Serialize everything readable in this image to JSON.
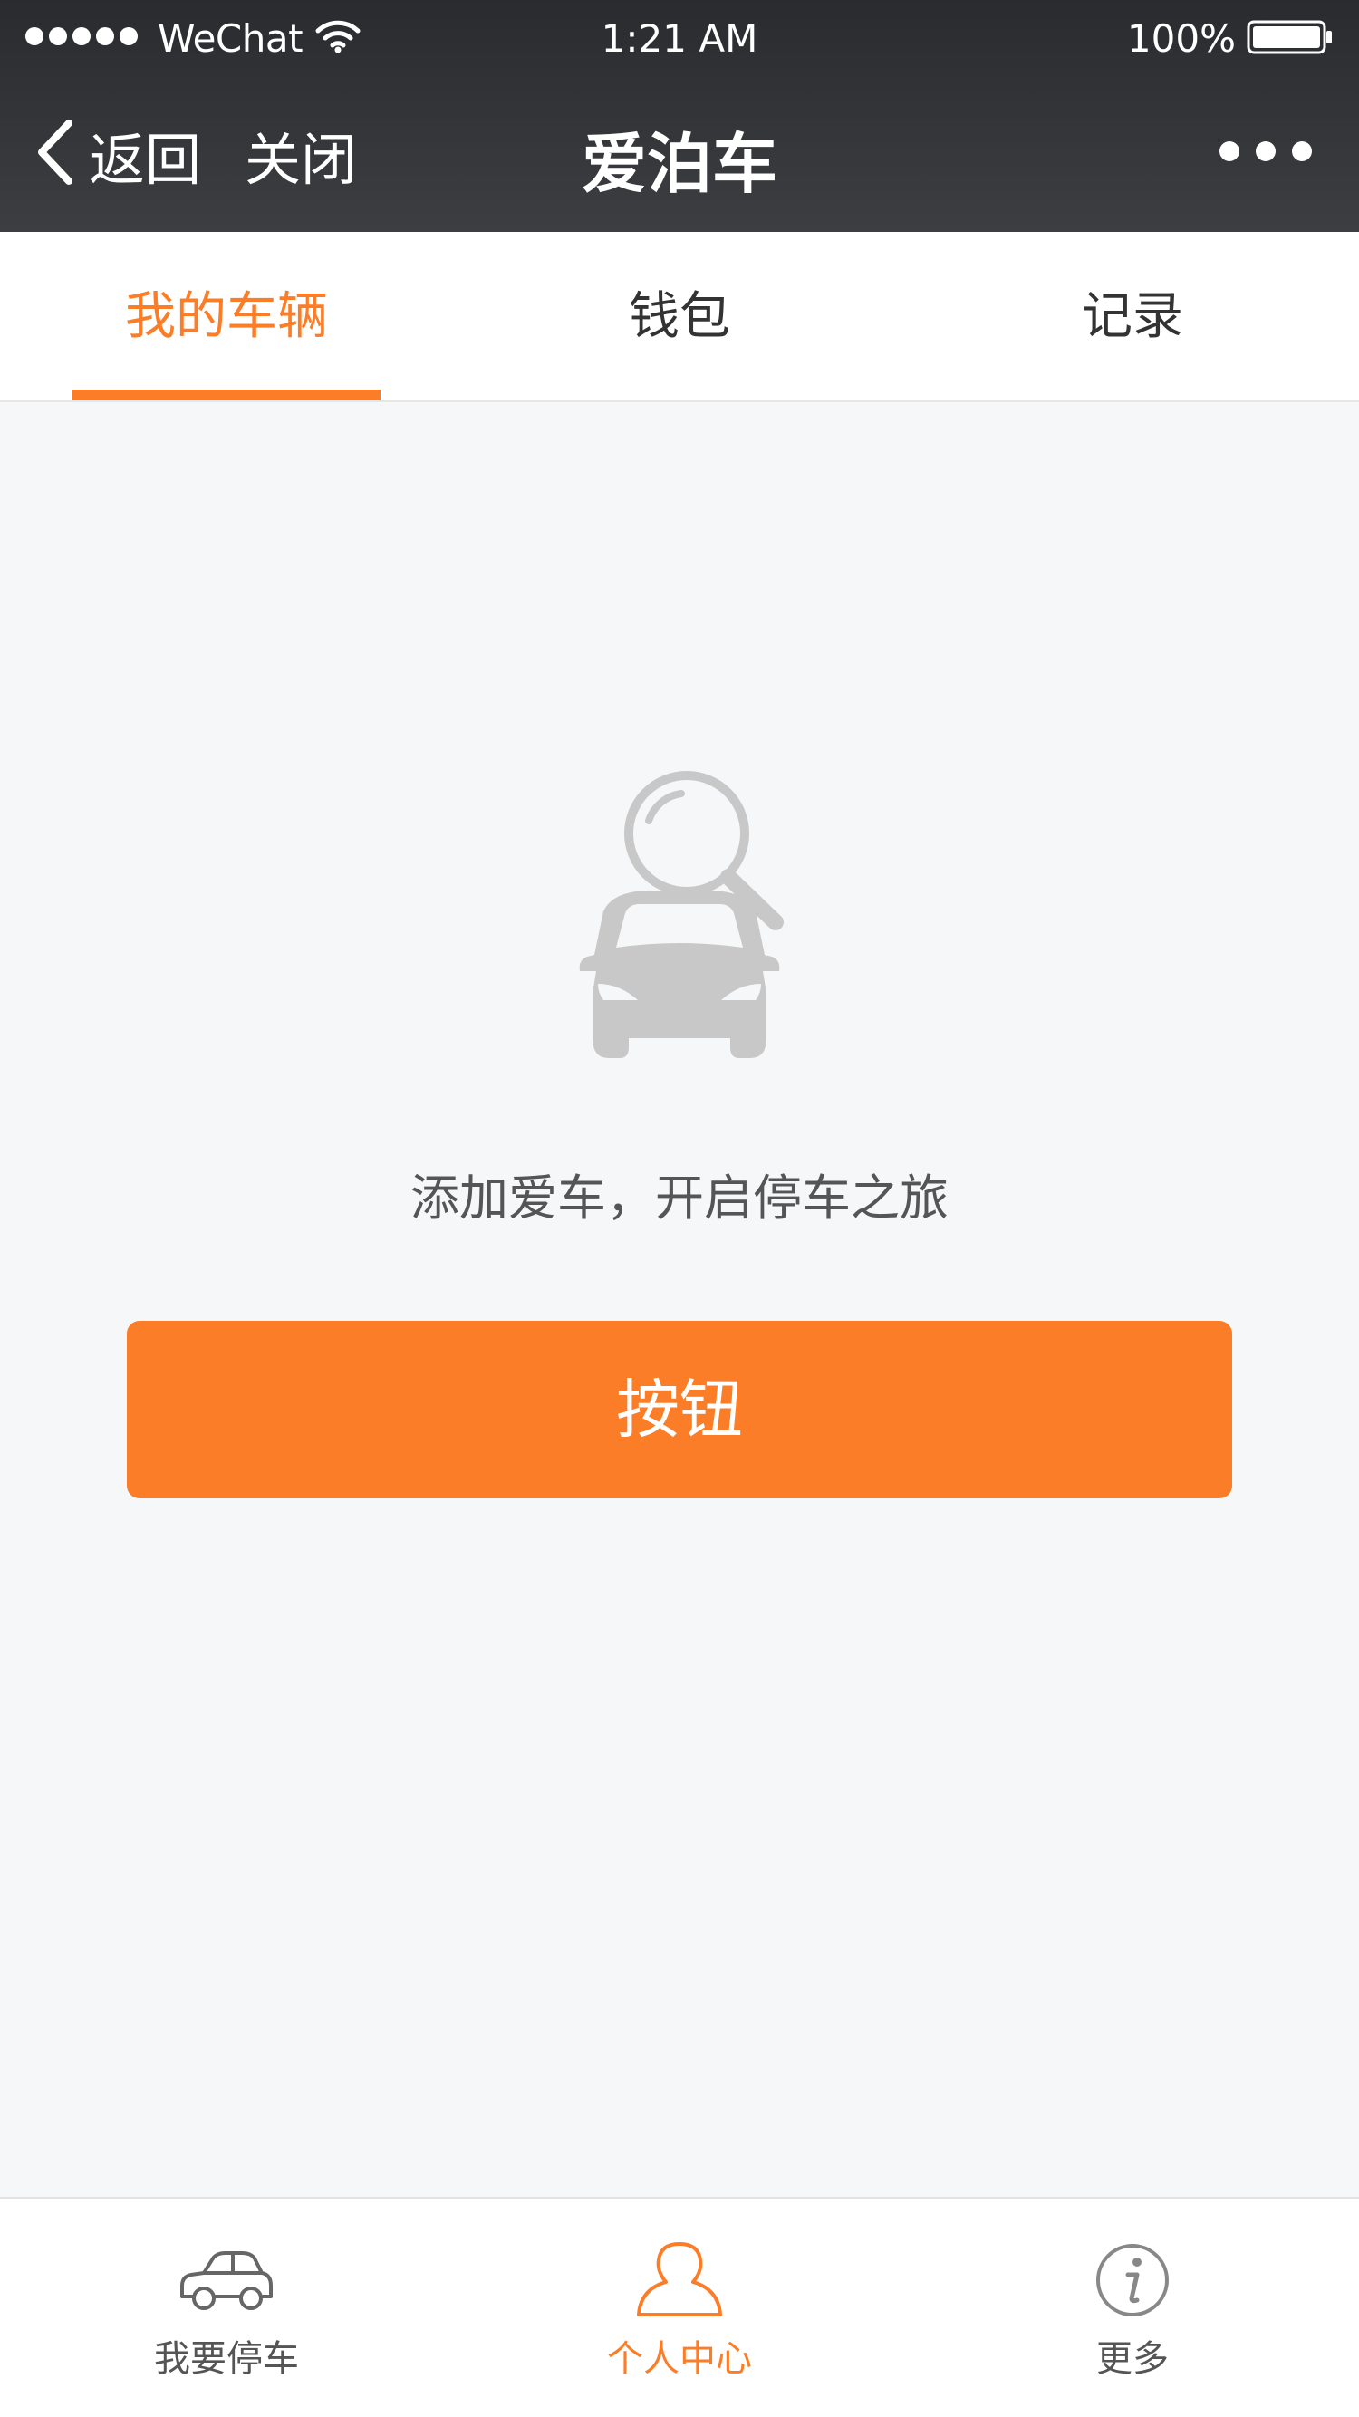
{
  "status_bar": {
    "carrier": "WeChat",
    "time": "1:21 AM",
    "battery": "100%"
  },
  "nav": {
    "back_label": "返回",
    "close_label": "关闭",
    "title": "爱泊车"
  },
  "tabs": [
    {
      "label": "我的车辆",
      "active": true
    },
    {
      "label": "钱包",
      "active": false
    },
    {
      "label": "记录",
      "active": false
    }
  ],
  "empty_state": {
    "message": "添加爱车，开启停车之旅",
    "button_label": "按钮"
  },
  "tabbar": [
    {
      "label": "我要停车",
      "icon": "car-icon",
      "active": false
    },
    {
      "label": "个人中心",
      "icon": "person-icon",
      "active": true
    },
    {
      "label": "更多",
      "icon": "info-icon",
      "active": false
    }
  ],
  "colors": {
    "accent": "#fc7d28",
    "header_bg": "#2a2b2e",
    "page_bg": "#f6f7f9",
    "muted_icon": "#c8c8c8"
  }
}
